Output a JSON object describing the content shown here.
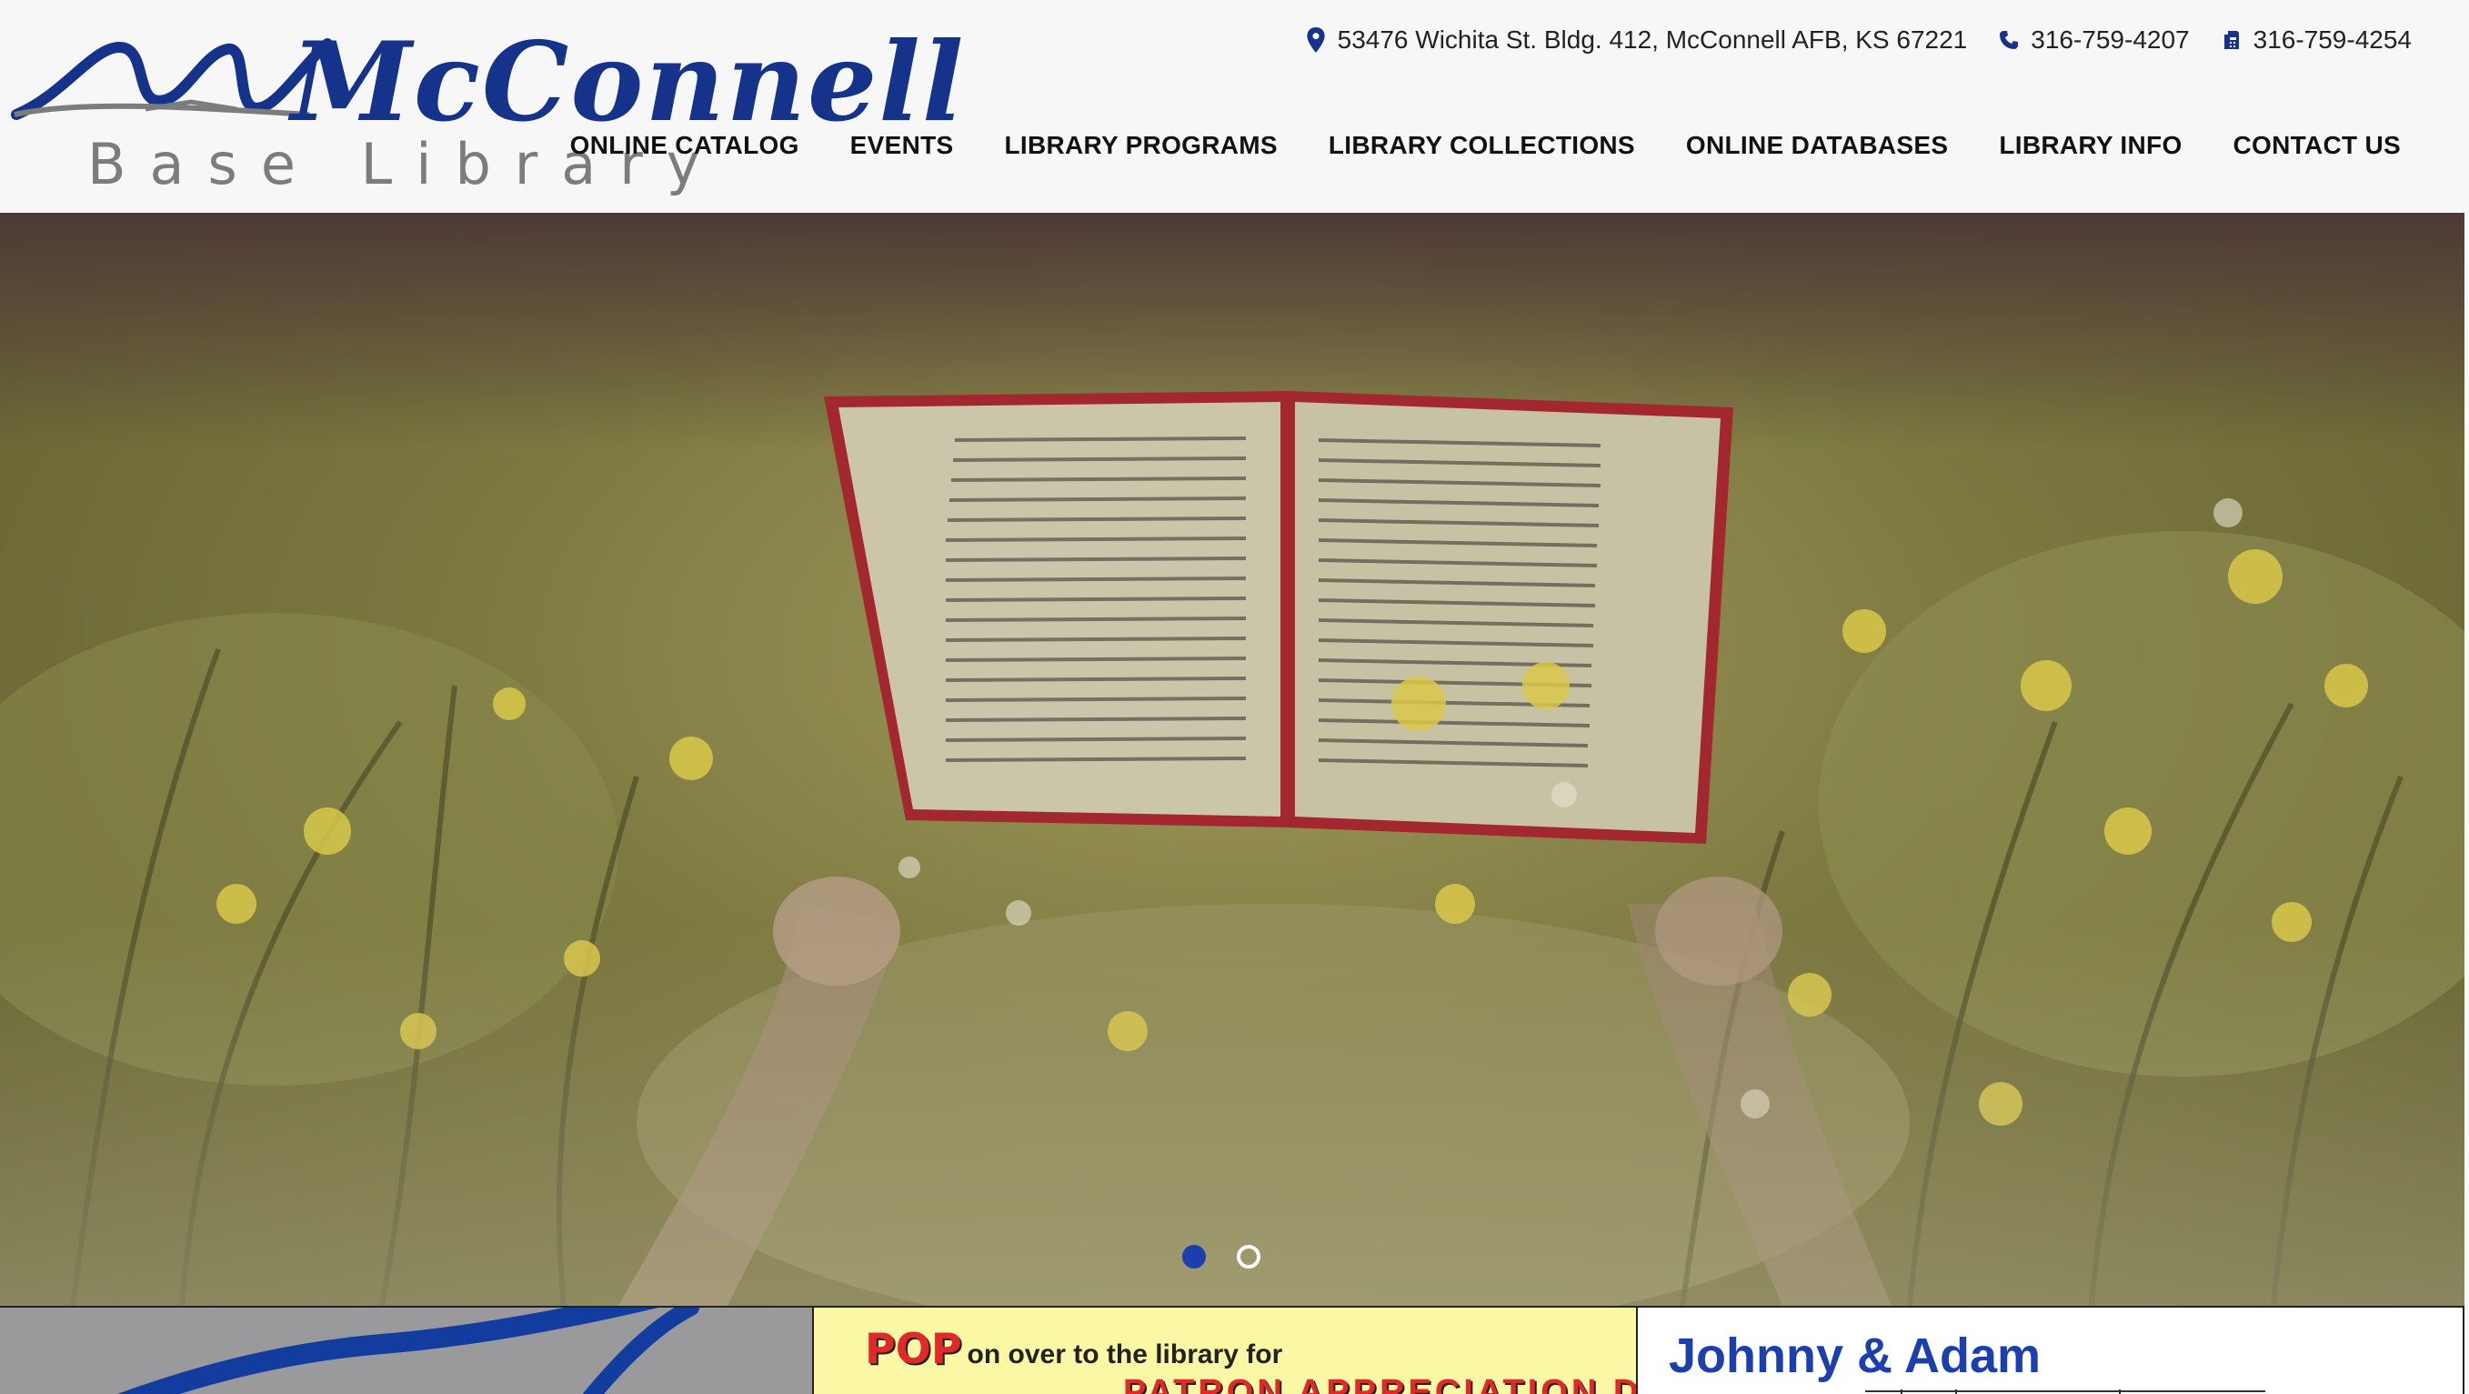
{
  "header": {
    "logo": {
      "script_text": "McConnell",
      "subtitle": "Base Library"
    },
    "contact": {
      "address": "53476 Wichita St. Bldg. 412, McConnell AFB, KS 67221",
      "phone": "316-759-4207",
      "fax": "316-759-4254",
      "icons": [
        "map-pin-icon",
        "phone-icon",
        "fax-icon"
      ]
    },
    "nav": [
      {
        "label": "ONLINE CATALOG"
      },
      {
        "label": "EVENTS"
      },
      {
        "label": "LIBRARY PROGRAMS"
      },
      {
        "label": "LIBRARY COLLECTIONS"
      },
      {
        "label": "ONLINE DATABASES"
      },
      {
        "label": "LIBRARY INFO"
      },
      {
        "label": "CONTACT US"
      }
    ]
  },
  "hero": {
    "slide_count": 2,
    "active_slide": 1
  },
  "cards": {
    "card2": {
      "pop": "POP",
      "line1": "on over to the library for",
      "line2": "PATRON APPRECIATION DAY!"
    },
    "card3": {
      "title": "Johnny & Adam"
    }
  },
  "colors": {
    "brand_blue": "#15338a",
    "dot_active": "#1c3fae",
    "header_bg": "#f7f7f7"
  }
}
